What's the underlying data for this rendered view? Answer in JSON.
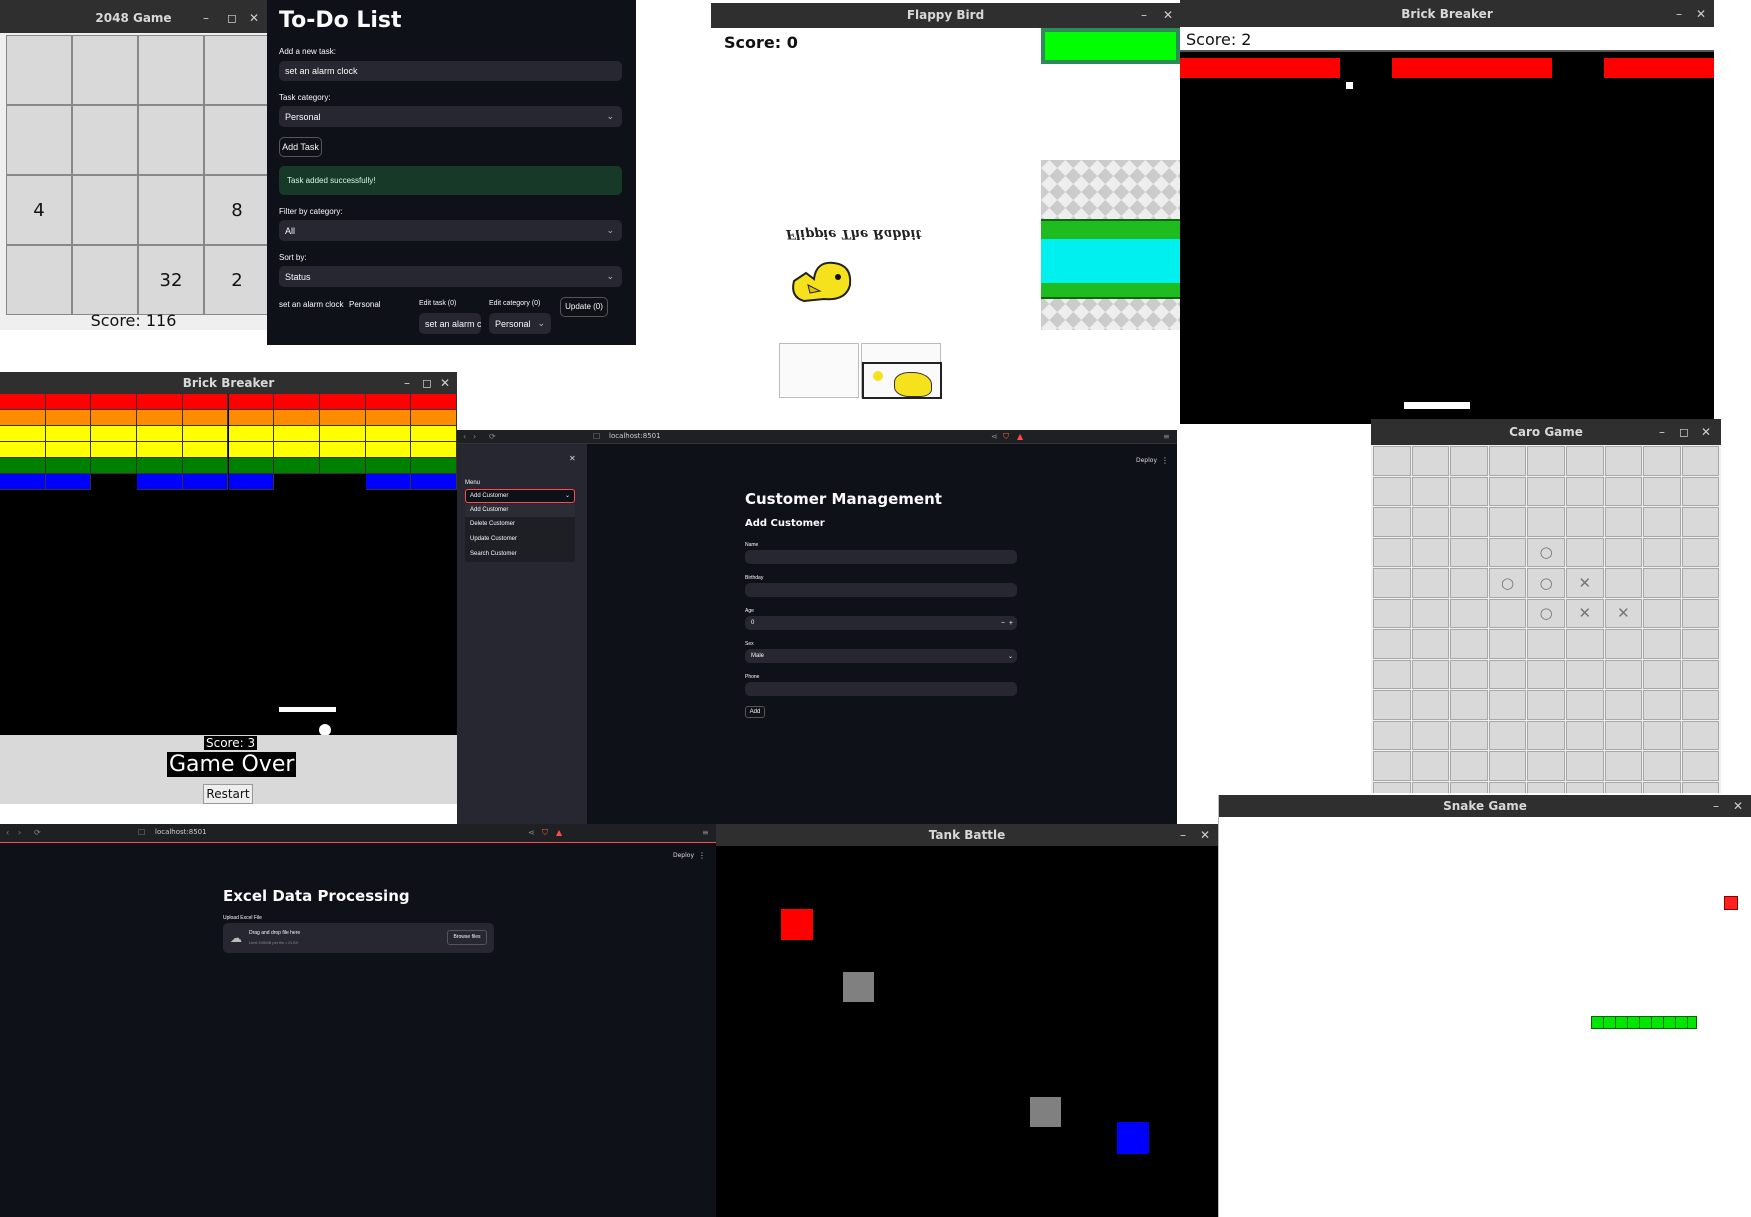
{
  "game2048": {
    "title": "2048 Game",
    "board": [
      [
        "",
        "",
        "",
        ""
      ],
      [
        "",
        "",
        "",
        ""
      ],
      [
        "4",
        "",
        "",
        "8"
      ],
      [
        "",
        "",
        "32",
        "2"
      ]
    ],
    "score": "Score: 116"
  },
  "todo": {
    "title": "To-Do List",
    "add_label": "Add a new task:",
    "add_value": "set an alarm clock",
    "category_label": "Task category:",
    "category_value": "Personal",
    "add_button": "Add Task",
    "success": "Task added successfully!",
    "filter_label": "Filter by category:",
    "filter_value": "All",
    "sort_label": "Sort by:",
    "sort_value": "Status",
    "task_text": "set an alarm clock",
    "task_category": "Personal",
    "edit_task_label": "Edit task (0)",
    "edit_task_value": "set an alarm cloc",
    "edit_category_label": "Edit category (0)",
    "edit_category_value": "Personal",
    "update_button": "Update (0)"
  },
  "flappy": {
    "title": "Flappy Bird",
    "score": "Score: 0",
    "bird_caption": "Flippie The Rabbit"
  },
  "brick1": {
    "title": "Brick Breaker",
    "score": "Score: 2"
  },
  "brick2": {
    "title": "Brick Breaker",
    "score": "Score: 3",
    "game_over": "Game Over",
    "restart": "Restart",
    "row_colors": [
      "#ff0000",
      "#ff8c00",
      "#ffff00",
      "#ffff00",
      "#008000",
      "#0000ff"
    ]
  },
  "customer": {
    "url": "localhost:8501",
    "deploy": "Deploy",
    "menu_label": "Menu",
    "menu_value": "Add Customer",
    "menu_options": [
      "Add Customer",
      "Delete Customer",
      "Update Customer",
      "Search Customer"
    ],
    "title": "Customer Management",
    "subtitle": "Add Customer",
    "name_label": "Name",
    "birthday_label": "Birthday",
    "age_label": "Age",
    "age_value": "0",
    "sex_label": "Sex",
    "sex_value": "Male",
    "phone_label": "Phone",
    "add_button": "Add"
  },
  "caro": {
    "title": "Caro Game",
    "marks": [
      {
        "r": 3,
        "c": 4,
        "m": "○"
      },
      {
        "r": 4,
        "c": 3,
        "m": "○"
      },
      {
        "r": 4,
        "c": 4,
        "m": "○"
      },
      {
        "r": 4,
        "c": 5,
        "m": "✕"
      },
      {
        "r": 5,
        "c": 4,
        "m": "○"
      },
      {
        "r": 5,
        "c": 5,
        "m": "✕"
      },
      {
        "r": 5,
        "c": 6,
        "m": "✕"
      }
    ]
  },
  "snake": {
    "title": "Snake Game"
  },
  "excel": {
    "url": "localhost:8501",
    "deploy": "Deploy",
    "title": "Excel Data Processing",
    "upload_label": "Upload Excel File",
    "drop_text": "Drag and drop file here",
    "limit_text": "Limit 200MB per file • XLSX",
    "browse_button": "Browse files"
  },
  "tank": {
    "title": "Tank Battle"
  },
  "colors": {
    "streamlit_bg": "#0e1117",
    "streamlit_sidebar": "#262730",
    "success_bg": "#173928",
    "accent_red": "#ff4b4b",
    "snake_green": "#00e600"
  }
}
